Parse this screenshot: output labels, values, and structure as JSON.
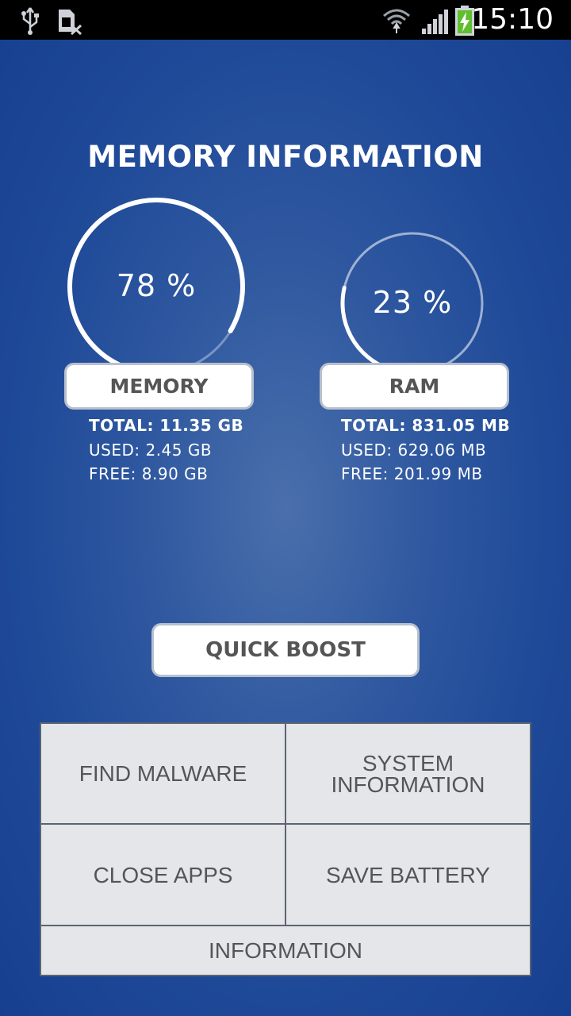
{
  "status_bar": {
    "time": "15:10",
    "icons": [
      "usb-icon",
      "no-sim-icon",
      "wifi-icon",
      "signal-icon",
      "battery-charging-icon"
    ]
  },
  "title": "MEMORY INFORMATION",
  "memory": {
    "percent_label": "78 %",
    "percent": 78,
    "label": "MEMORY",
    "total": "TOTAL: 11.35 GB",
    "used": "USED: 2.45 GB",
    "free": "FREE: 8.90 GB"
  },
  "ram": {
    "percent_label": "23 %",
    "percent": 23,
    "label": "RAM",
    "total": "TOTAL: 831.05 MB",
    "used": "USED: 629.06 MB",
    "free": "FREE: 201.99 MB"
  },
  "quick_boost": "QUICK BOOST",
  "menu": {
    "find_malware": "FIND MALWARE",
    "system_information_line1": "SYSTEM",
    "system_information_line2": "INFORMATION",
    "close_apps": "CLOSE APPS",
    "save_battery": "SAVE BATTERY",
    "information": "INFORMATION"
  },
  "colors": {
    "background": "#2f58a0",
    "button_bg": "#ffffff",
    "grid_bg": "#e4e6e9",
    "text_dark": "#555555"
  }
}
